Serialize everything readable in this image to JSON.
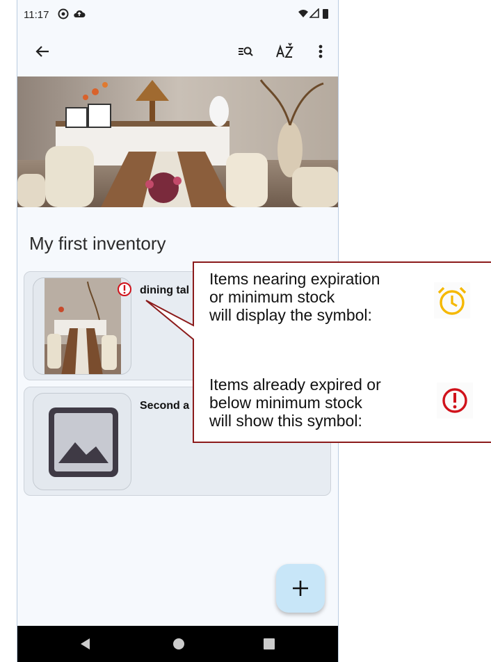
{
  "status_bar": {
    "time": "11:17"
  },
  "app_bar": {
    "back_icon": "arrow-left-icon",
    "actions": [
      "search-list-icon",
      "sort-az-icon",
      "more-vert-icon"
    ]
  },
  "inventory": {
    "title": "My first inventory",
    "items": [
      {
        "name": "dining tal",
        "status_icon": "error-icon"
      },
      {
        "name": "Second a",
        "status_icon": ""
      }
    ]
  },
  "fab": {
    "label": "+"
  },
  "callout": {
    "expiring_text": "Items nearing expiration\nor minimum stock\nwill display the symbol:",
    "expired_text": "Items already expired or\nbelow minimum stock\nwill show this symbol:",
    "expiring_icon": "alarm-clock-icon",
    "expired_icon": "error-icon",
    "colors": {
      "warning": "#f5b800",
      "error": "#d0121b",
      "border": "#8b1a1a"
    }
  }
}
